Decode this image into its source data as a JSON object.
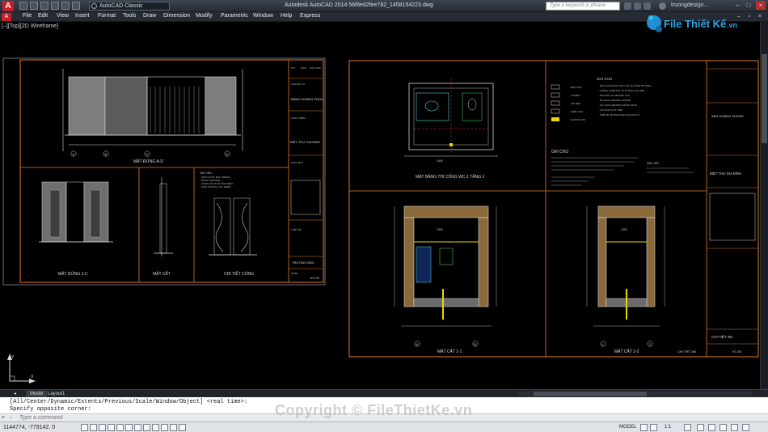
{
  "titlebar": {
    "app_logo": "A",
    "workspace": "AutoCAD Classic",
    "title": "Autodesk AutoCAD 2014     56f8ed2fee782_1458154223.dwg",
    "search_placeholder": "Type a keyword or phrase",
    "user": "truongdesign..."
  },
  "menu": [
    "File",
    "Edit",
    "View",
    "Insert",
    "Format",
    "Tools",
    "Draw",
    "Dimension",
    "Modify",
    "Parametric",
    "Window",
    "Help",
    "Express"
  ],
  "viewport_label": "[–][Top][2D Wireframe]",
  "sheet_left": {
    "elevation_ad": "MẶT ĐỨNG A-D",
    "elevation_1c": "MẶT ĐỨNG 1-C",
    "section": "MẶT CẮT",
    "gate_detail": "CHI TIẾT CỔNG",
    "titleblock": {
      "company": "ĐẶNG HOÀNG PHÚC",
      "project": "BIỆT THỰ GIA ĐÌNH",
      "designer": "TRƯƠNG BẢO",
      "sheet": "KT-05",
      "r1": "STT",
      "r2": "NGÀY",
      "r3": "NỘI DUNG",
      "r4": "CHỦ ĐẦU TƯ",
      "r5": "CÔNG TRÌNH",
      "r6": "HẠNG MỤC",
      "r7": "THIẾT KẾ",
      "r8": "SỐ BV"
    },
    "axes": [
      "A",
      "B",
      "C",
      "D"
    ],
    "notes": [
      "GHI CHÚ:",
      "- SƠN NƯỚC MÀU TRẮNG",
      "- ỐP ĐÁ GRANITE",
      "- CỔNG SẮT SƠN TĨNH ĐIỆN",
      "- KÍNH CƯỜNG LỰC 10MM"
    ]
  },
  "sheet_right": {
    "plan_title": "MẶT BẰNG THI CÔNG WC-1 TẦNG 1",
    "section_11": "MẶT CẮT 1-1",
    "section_22": "MẶT CẮT 2-2",
    "detail_w1": "CHI TIẾT W1",
    "notes_heading": "GHI CHÚ",
    "notes_heading2": "GHI CHÚ",
    "notes_heading3": "GHI CHÚ:",
    "legend": [
      "BỒN CẦU",
      "LAVABO",
      "VÒI SEN",
      "PHỄU THU",
      "GƯƠNG SOI"
    ],
    "notes": [
      "- KÍCH THƯỚC ĐO THỰC TẾ TẠI CÔNG TRƯỜNG",
      "- CHỐNG THẤM SÀN VÀ TƯỜNG CAO 1800",
      "- SÀN DỐC 1% VỀ PHỄU THU",
      "- ỐP GẠCH CERAMIC 300X600",
      "- LÁT GẠCH 300X300 CHỐNG TRƠN",
      "- CỬA NHỰA LÕI THÉP",
      "- THIẾT BỊ VỆ SINH THEO CHỦ ĐẦU TƯ"
    ],
    "titleblock": {
      "company": "ANH HOÀNG PHÚNG",
      "project": "BIỆT THỰ GIA ĐÌNH",
      "sheet": "KT-06",
      "detail": "CHI TIẾT W1"
    },
    "dims": [
      "1600",
      "2300",
      "1200",
      "900"
    ],
    "axes": [
      "1",
      "2",
      "A",
      "B",
      "C",
      "D"
    ]
  },
  "tabs": [
    "Model",
    "Layout1"
  ],
  "command": {
    "history1": "[All/Center/Dynamic/Extents/Previous/Scale/Window/Object] <real time>:",
    "history2": "Specify opposite corner:",
    "placeholder": "Type a command"
  },
  "status": {
    "coords": "1144774, -779142, 0",
    "model": "MODEL",
    "scale": "1:1"
  },
  "watermark": "Copyright © FileThietKe.vn",
  "logo_text": "File Thiết Kế",
  "logo_domain": ".vn",
  "colors": {
    "frame": "#e07a2a",
    "line": "#d8d8d8",
    "yellow": "#e8d800",
    "cyan": "#58d0e0",
    "red": "#d23c3c",
    "green": "#3ec84a",
    "blue": "#3070ff"
  }
}
